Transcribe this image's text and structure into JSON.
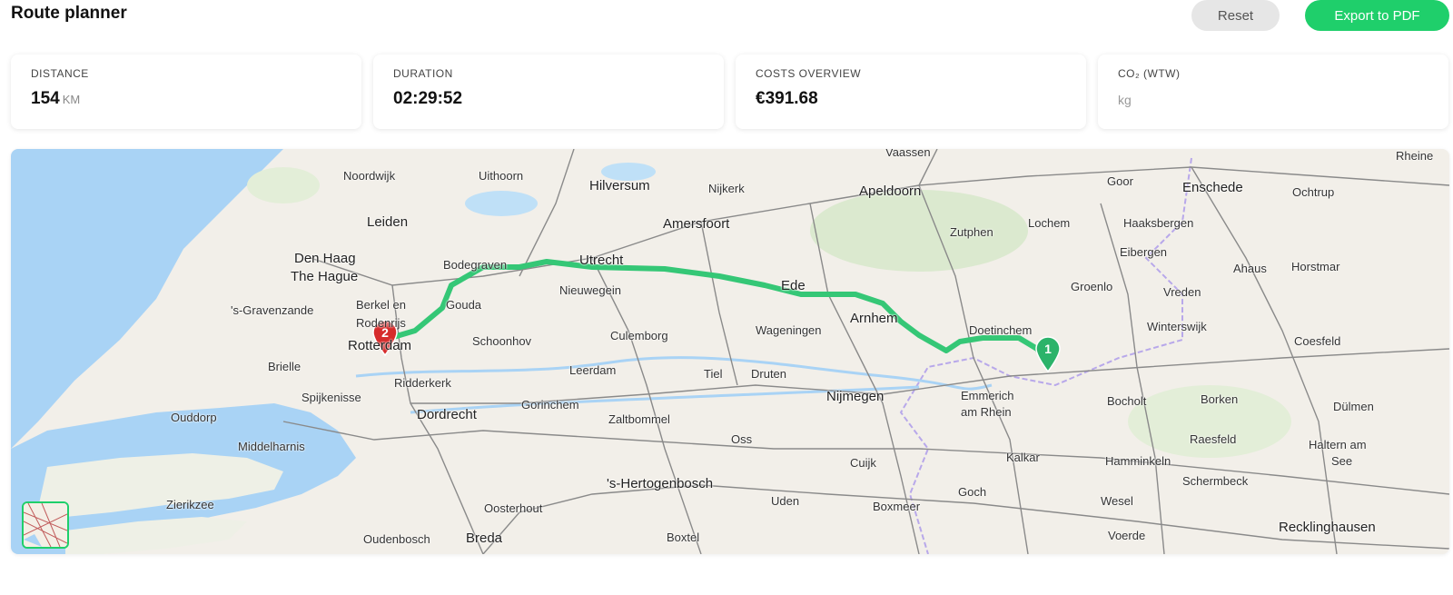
{
  "header": {
    "title": "Route planner",
    "reset_label": "Reset",
    "export_label": "Export to PDF"
  },
  "stats": {
    "distance": {
      "label": "DISTANCE",
      "value": "154",
      "unit": "KM"
    },
    "duration": {
      "label": "DURATION",
      "value": "02:29:52"
    },
    "costs": {
      "label": "COSTS OVERVIEW",
      "value": "€391.68"
    },
    "co2": {
      "label": "CO₂ (WTW)",
      "unit": "kg"
    }
  },
  "map": {
    "route_color": "#35c776",
    "markers": [
      {
        "number": "1",
        "color": "#2bb36a",
        "name": "start-marker"
      },
      {
        "number": "2",
        "color": "#d62b2b",
        "name": "end-marker"
      }
    ],
    "places": [
      {
        "name": "Noordwijk",
        "big": false
      },
      {
        "name": "Uithoorn",
        "big": false
      },
      {
        "name": "Hilversum",
        "big": true
      },
      {
        "name": "Nijkerk",
        "big": false
      },
      {
        "name": "Apeldoorn",
        "big": true
      },
      {
        "name": "Goor",
        "big": false
      },
      {
        "name": "Enschede",
        "big": true
      },
      {
        "name": "Ochtrup",
        "big": false
      },
      {
        "name": "Rheine",
        "big": false
      },
      {
        "name": "Leiden",
        "big": true
      },
      {
        "name": "Amersfoort",
        "big": true
      },
      {
        "name": "Lochem",
        "big": false
      },
      {
        "name": "Haaksbergen",
        "big": false
      },
      {
        "name": "Den Haag",
        "big": true
      },
      {
        "name": "The Hague",
        "big": true
      },
      {
        "name": "Zutphen",
        "big": false
      },
      {
        "name": "Eibergen",
        "big": false
      },
      {
        "name": "Bodegraven",
        "big": false
      },
      {
        "name": "Utrecht",
        "big": true
      },
      {
        "name": "Ahaus",
        "big": false
      },
      {
        "name": "Horstmar",
        "big": false
      },
      {
        "name": "Nieuwegein",
        "big": false
      },
      {
        "name": "Ede",
        "big": true
      },
      {
        "name": "Groenlo",
        "big": false
      },
      {
        "name": "Vreden",
        "big": false
      },
      {
        "name": "'s-Gravenzande",
        "big": false
      },
      {
        "name": "Berkel en",
        "big": false
      },
      {
        "name": "Gouda",
        "big": false
      },
      {
        "name": "Rodenrijs",
        "big": false
      },
      {
        "name": "Wageningen",
        "big": false
      },
      {
        "name": "Arnhem",
        "big": true
      },
      {
        "name": "Doetinchem",
        "big": false
      },
      {
        "name": "Winterswijk",
        "big": false
      },
      {
        "name": "Schoonhov",
        "big": false
      },
      {
        "name": "Culemborg",
        "big": false
      },
      {
        "name": "Rotterdam",
        "big": true
      },
      {
        "name": "Coesfeld",
        "big": false
      },
      {
        "name": "Brielle",
        "big": false
      },
      {
        "name": "Leerdam",
        "big": false
      },
      {
        "name": "Tiel",
        "big": false
      },
      {
        "name": "Druten",
        "big": false
      },
      {
        "name": "Ridderkerk",
        "big": false
      },
      {
        "name": "Spijkenisse",
        "big": false
      },
      {
        "name": "Nijmegen",
        "big": true
      },
      {
        "name": "Emmerich",
        "big": false
      },
      {
        "name": "am Rhein",
        "big": false
      },
      {
        "name": "Bocholt",
        "big": false
      },
      {
        "name": "Borken",
        "big": false
      },
      {
        "name": "Dülmen",
        "big": false
      },
      {
        "name": "Ouddorp",
        "big": false
      },
      {
        "name": "Gorinchem",
        "big": false
      },
      {
        "name": "Dordrecht",
        "big": true
      },
      {
        "name": "Zaltbommel",
        "big": false
      },
      {
        "name": "Middelharnis",
        "big": false
      },
      {
        "name": "Oss",
        "big": false
      },
      {
        "name": "Kalkar",
        "big": false
      },
      {
        "name": "Raesfeld",
        "big": false
      },
      {
        "name": "Haltern am",
        "big": false
      },
      {
        "name": "See",
        "big": false
      },
      {
        "name": "Hamminkeln",
        "big": false
      },
      {
        "name": "Cuijk",
        "big": false
      },
      {
        "name": "'s-Hertogenbosch",
        "big": true
      },
      {
        "name": "Schermbeck",
        "big": false
      },
      {
        "name": "Zierikzee",
        "big": false
      },
      {
        "name": "Uden",
        "big": false
      },
      {
        "name": "Goch",
        "big": false
      },
      {
        "name": "Wesel",
        "big": false
      },
      {
        "name": "Oosterhout",
        "big": false
      },
      {
        "name": "Boxmeer",
        "big": false
      },
      {
        "name": "Recklinghausen",
        "big": true
      },
      {
        "name": "Voerde",
        "big": false
      },
      {
        "name": "Oudenbosch",
        "big": false
      },
      {
        "name": "Breda",
        "big": true
      },
      {
        "name": "Boxtel",
        "big": false
      },
      {
        "name": "Vaassen",
        "big": false
      }
    ]
  }
}
